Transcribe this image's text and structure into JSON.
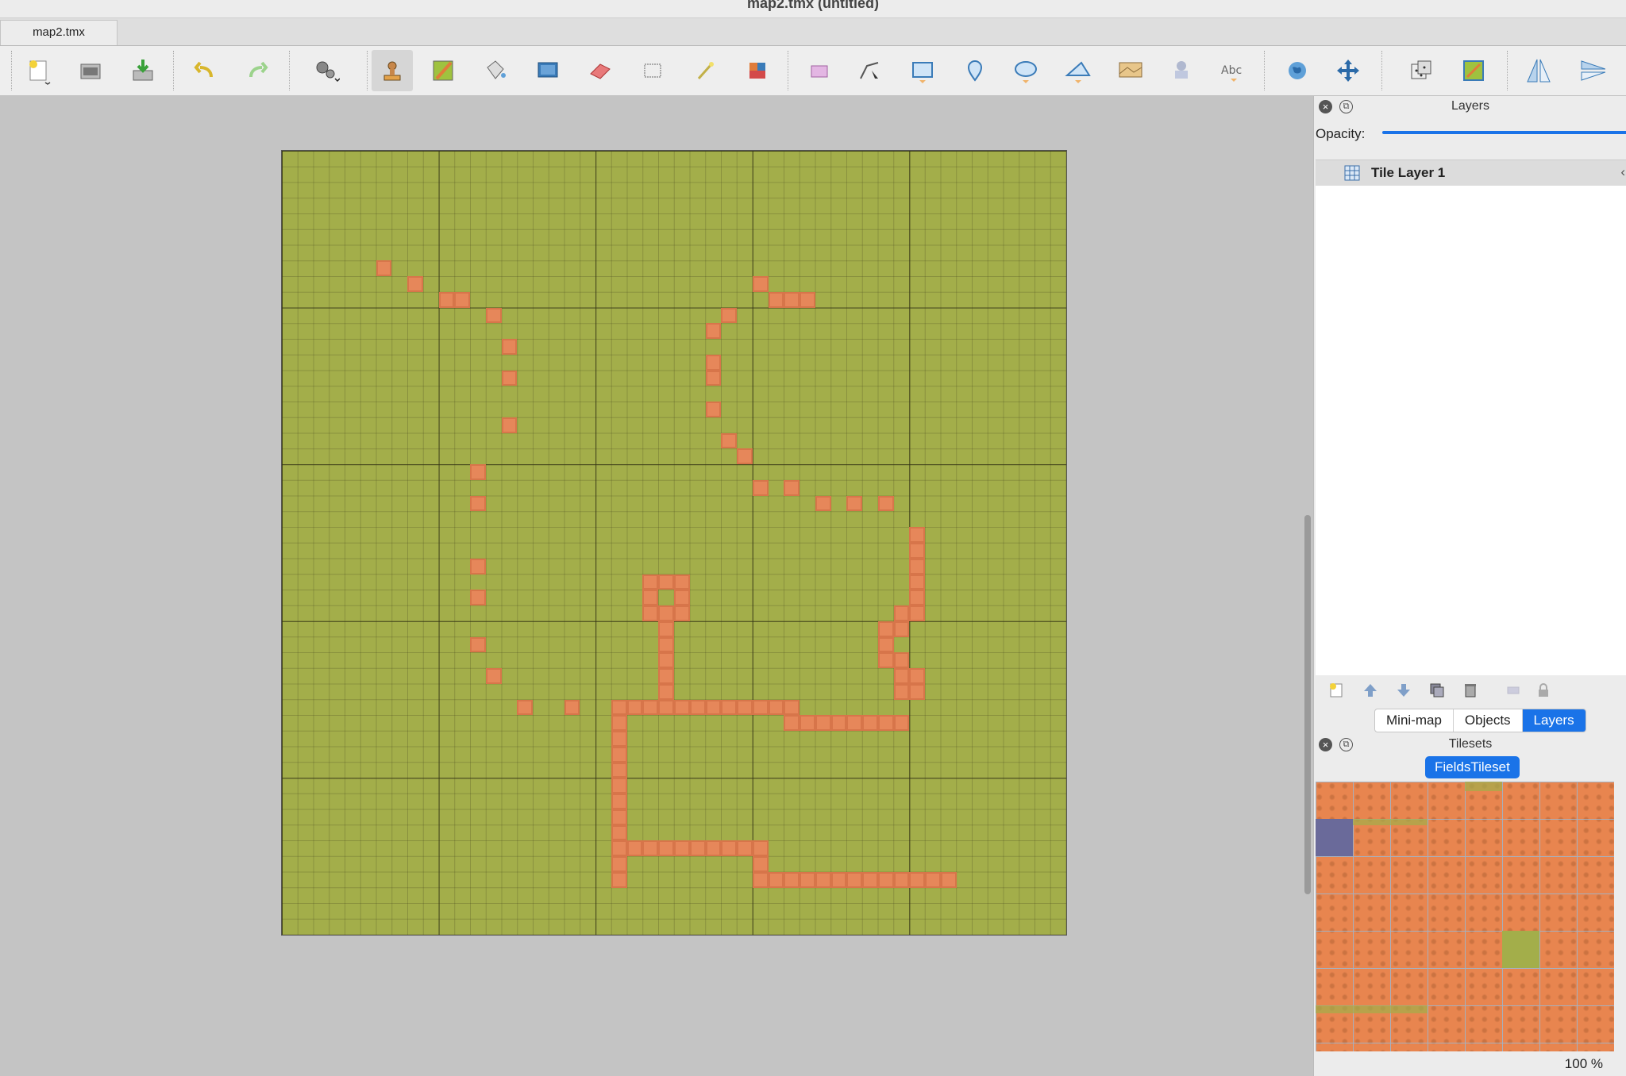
{
  "window": {
    "title": "map2.tmx (untitled)"
  },
  "document_tab": {
    "label": "map2.tmx"
  },
  "toolbar": {
    "items": [
      "new-map",
      "open-map",
      "save-map",
      "undo",
      "redo",
      "commands",
      "stamp-brush",
      "terrain-brush",
      "bucket-fill",
      "shape-fill",
      "eraser",
      "rectangular-select",
      "magic-wand",
      "select-same-tile",
      "select-objects",
      "edit-polygons",
      "insert-rectangle",
      "insert-point",
      "insert-ellipse",
      "insert-polygon",
      "insert-tile",
      "insert-template",
      "insert-text",
      "world-tool",
      "move-tool",
      "random-mode",
      "wang-fill",
      "flip-horizontal",
      "flip-vertical"
    ],
    "active": "stamp-brush"
  },
  "layers_panel": {
    "title": "Layers",
    "opacity_label": "Opacity:",
    "opacity_value": 1.0,
    "layers": [
      {
        "name": "Tile Layer 1",
        "selected": true
      }
    ]
  },
  "bottom_tabs": {
    "items": [
      "Mini-map",
      "Objects",
      "Layers"
    ],
    "selected": "Layers"
  },
  "tilesets_panel": {
    "title": "Tilesets",
    "active_tileset": "FieldsTileset",
    "zoom": "100 %"
  },
  "map": {
    "columns": 50,
    "rows": 50,
    "colors": {
      "ground": "#a3ae4a",
      "path": "#e6875a"
    },
    "path_tiles": [
      [
        6,
        7
      ],
      [
        8,
        8
      ],
      [
        10,
        9
      ],
      [
        11,
        9
      ],
      [
        13,
        10
      ],
      [
        14,
        12
      ],
      [
        14,
        14
      ],
      [
        14,
        17
      ],
      [
        12,
        20
      ],
      [
        12,
        22
      ],
      [
        12,
        26
      ],
      [
        12,
        28
      ],
      [
        12,
        31
      ],
      [
        13,
        33
      ],
      [
        15,
        35
      ],
      [
        18,
        35
      ],
      [
        30,
        8
      ],
      [
        31,
        9
      ],
      [
        32,
        9
      ],
      [
        33,
        9
      ],
      [
        28,
        10
      ],
      [
        27,
        11
      ],
      [
        27,
        13
      ],
      [
        27,
        14
      ],
      [
        27,
        16
      ],
      [
        28,
        18
      ],
      [
        29,
        19
      ],
      [
        30,
        21
      ],
      [
        32,
        21
      ],
      [
        34,
        22
      ],
      [
        36,
        22
      ],
      [
        38,
        22
      ],
      [
        40,
        24
      ],
      [
        40,
        25
      ],
      [
        40,
        26
      ],
      [
        40,
        27
      ],
      [
        40,
        28
      ],
      [
        39,
        29
      ],
      [
        40,
        29
      ],
      [
        38,
        30
      ],
      [
        39,
        30
      ],
      [
        38,
        31
      ],
      [
        38,
        32
      ],
      [
        39,
        32
      ],
      [
        39,
        33
      ],
      [
        40,
        33
      ],
      [
        39,
        34
      ],
      [
        40,
        34
      ],
      [
        23,
        27
      ],
      [
        24,
        27
      ],
      [
        25,
        27
      ],
      [
        23,
        28
      ],
      [
        25,
        28
      ],
      [
        23,
        29
      ],
      [
        24,
        29
      ],
      [
        25,
        29
      ],
      [
        24,
        30
      ],
      [
        24,
        31
      ],
      [
        24,
        32
      ],
      [
        24,
        33
      ],
      [
        24,
        34
      ],
      [
        21,
        35
      ],
      [
        22,
        35
      ],
      [
        23,
        35
      ],
      [
        24,
        35
      ],
      [
        25,
        35
      ],
      [
        26,
        35
      ],
      [
        27,
        35
      ],
      [
        28,
        35
      ],
      [
        29,
        35
      ],
      [
        30,
        35
      ],
      [
        31,
        35
      ],
      [
        32,
        35
      ],
      [
        32,
        36
      ],
      [
        33,
        36
      ],
      [
        34,
        36
      ],
      [
        35,
        36
      ],
      [
        36,
        36
      ],
      [
        37,
        36
      ],
      [
        38,
        36
      ],
      [
        39,
        36
      ],
      [
        21,
        36
      ],
      [
        21,
        37
      ],
      [
        21,
        38
      ],
      [
        21,
        39
      ],
      [
        21,
        40
      ],
      [
        21,
        41
      ],
      [
        21,
        42
      ],
      [
        21,
        43
      ],
      [
        21,
        44
      ],
      [
        21,
        45
      ],
      [
        21,
        46
      ],
      [
        22,
        44
      ],
      [
        23,
        44
      ],
      [
        24,
        44
      ],
      [
        25,
        44
      ],
      [
        26,
        44
      ],
      [
        27,
        44
      ],
      [
        28,
        44
      ],
      [
        29,
        44
      ],
      [
        30,
        44
      ],
      [
        30,
        45
      ],
      [
        30,
        46
      ],
      [
        31,
        46
      ],
      [
        32,
        46
      ],
      [
        33,
        46
      ],
      [
        34,
        46
      ],
      [
        35,
        46
      ],
      [
        36,
        46
      ],
      [
        37,
        46
      ],
      [
        38,
        46
      ],
      [
        39,
        46
      ],
      [
        40,
        46
      ],
      [
        41,
        46
      ],
      [
        42,
        46
      ]
    ]
  }
}
